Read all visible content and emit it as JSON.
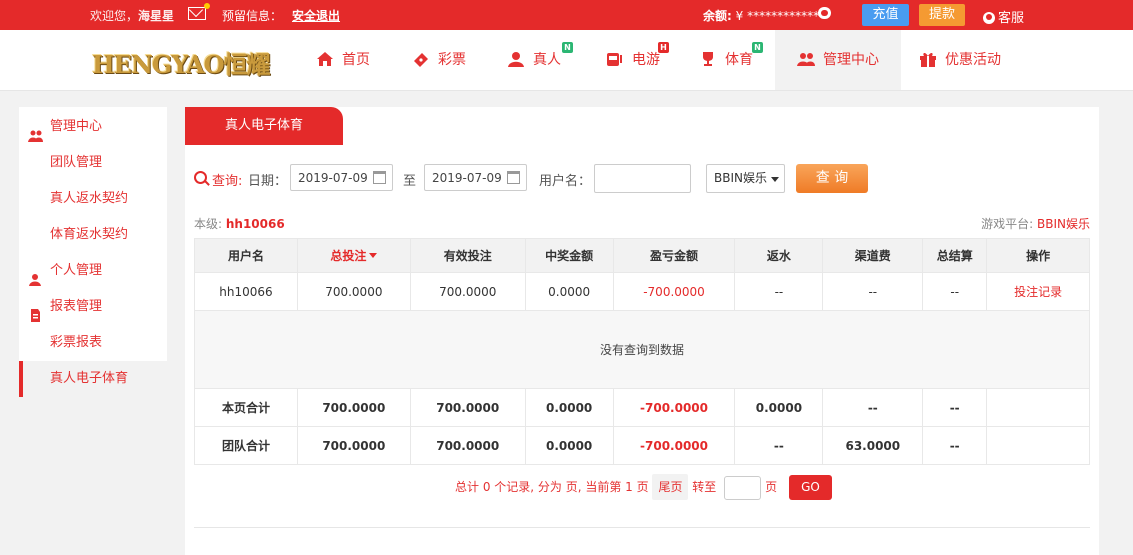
{
  "topbar": {
    "welcome_prefix": "欢迎您，",
    "username": "海星星",
    "notice_label": "预留信息：",
    "logout_label": "安全退出",
    "balance_label": "余额:",
    "balance_value": "¥ ************",
    "recharge_label": "充值",
    "withdraw_label": "提款",
    "service_label": "客服"
  },
  "logo": {
    "text": "HENGYAO恒耀"
  },
  "nav": [
    {
      "label": "首页",
      "icon": "home-icon",
      "badge": ""
    },
    {
      "label": "彩票",
      "icon": "lottery-ticket-icon",
      "badge": ""
    },
    {
      "label": "真人",
      "icon": "live-dealer-icon",
      "badge": "N"
    },
    {
      "label": "电游",
      "icon": "slot-machine-icon",
      "badge": "H"
    },
    {
      "label": "体育",
      "icon": "trophy-icon",
      "badge": "N"
    },
    {
      "label": "管理中心",
      "icon": "users-icon",
      "badge": ""
    },
    {
      "label": "优惠活动",
      "icon": "gift-icon",
      "badge": ""
    }
  ],
  "sidebar": {
    "items": [
      {
        "label": "管理中心",
        "type": "group",
        "icon": "users-icon"
      },
      {
        "label": "团队管理",
        "type": "sub"
      },
      {
        "label": "真人返水契约",
        "type": "sub"
      },
      {
        "label": "体育返水契约",
        "type": "sub"
      },
      {
        "label": "个人管理",
        "type": "group",
        "icon": "user-icon"
      },
      {
        "label": "报表管理",
        "type": "group",
        "icon": "report-icon"
      },
      {
        "label": "彩票报表",
        "type": "sub"
      },
      {
        "label": "真人电子体育",
        "type": "sub",
        "active": true
      }
    ]
  },
  "panel": {
    "tab_label": "真人电子体育",
    "query": {
      "query_label": "查询:",
      "date_label": "日期：",
      "date_from": "2019-07-09",
      "to_label": "至",
      "date_to": "2019-07-09",
      "user_label": "用户名：",
      "user_value": "",
      "platform_select": "BBIN娱乐",
      "submit_label": "查 询"
    },
    "level_label": "本级:",
    "level_value": "hh10066",
    "platform_label": "游戏平台:",
    "platform_value": "BBIN娱乐"
  },
  "table": {
    "headers": [
      "用户名",
      "总投注",
      "有效投注",
      "中奖金额",
      "盈亏金额",
      "返水",
      "渠道费",
      "总结算",
      "操作"
    ],
    "rows": [
      [
        "hh10066",
        "700.0000",
        "700.0000",
        "0.0000",
        "-700.0000",
        "--",
        "--",
        "--",
        "投注记录"
      ]
    ],
    "empty_text": "没有查询到数据",
    "page_total": [
      "本页合计",
      "700.0000",
      "700.0000",
      "0.0000",
      "-700.0000",
      "0.0000",
      "--",
      "--",
      ""
    ],
    "team_total": [
      "团队合计",
      "700.0000",
      "700.0000",
      "0.0000",
      "-700.0000",
      "--",
      "63.0000",
      "--",
      ""
    ]
  },
  "pager": {
    "summary": "总计 0 个记录, 分为 页, 当前第 1 页",
    "last_label": "尾页",
    "goto_label": "转至",
    "page_unit": "页",
    "go_label": "GO"
  },
  "colors": {
    "brand_red": "#e42a2a",
    "recharge_blue": "#4a9cf0",
    "withdraw_orange": "#f59a32",
    "query_orange": "#f48a3c"
  }
}
